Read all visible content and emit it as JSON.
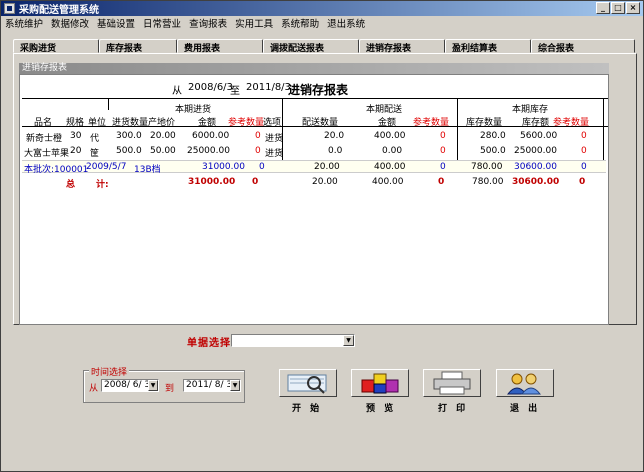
{
  "window": {
    "title": "采购配送管理系统"
  },
  "menu": [
    "系统维护",
    "数据修改",
    "基础设置",
    "日常营业",
    "查询报表",
    "实用工具",
    "系统帮助",
    "退出系统"
  ],
  "tabs": [
    "采购进货",
    "库存报表",
    "费用报表",
    "调拨配送报表",
    "进销存报表",
    "盈利结算表",
    "综合报表"
  ],
  "panel": {
    "header": "进销存报表"
  },
  "report": {
    "from_label": "从",
    "from_date": "2008/6/3",
    "to_label": "至",
    "to_date": "2011/8/3",
    "title": "进销存报表",
    "section_in": "本期进货",
    "section_out": "本期配送",
    "section_stock": "本期库存",
    "columns": {
      "name": "品名",
      "spec": "规格",
      "unit": "单位",
      "in_qty": "进货数量",
      "origin_price": "产地价",
      "in_amount": "金额",
      "in_ref_qty": "参考数量",
      "option": "选项",
      "out_qty": "配送数量",
      "out_amount": "金额",
      "out_ref_qty": "参考数量",
      "stock_qty": "库存数量",
      "stock_amount": "库存额",
      "stock_ref_qty": "参考数量"
    },
    "rows": [
      {
        "name": "新奇士橙",
        "spec": "30",
        "unit": "代",
        "in_qty": "300.0",
        "origin_price": "20.00",
        "in_amount": "6000.00",
        "in_ref": "0",
        "option": "进货",
        "out_qty": "20.0",
        "out_amount": "400.00",
        "out_ref": "0",
        "stock_qty": "280.0",
        "stock_amount": "5600.00",
        "stock_ref": "0"
      },
      {
        "name": "大富士苹果",
        "spec": "20",
        "unit": "筐",
        "in_qty": "500.0",
        "origin_price": "50.00",
        "in_amount": "25000.00",
        "in_ref": "0",
        "option": "进货",
        "out_qty": "0.0",
        "out_amount": "0.00",
        "out_ref": "0",
        "stock_qty": "500.0",
        "stock_amount": "25000.00",
        "stock_ref": "0"
      }
    ],
    "batch": {
      "label": "本批次:100001",
      "date": "2009/5/7",
      "code": "13B档",
      "in_amount": "31000.00",
      "in_ref": "0",
      "out_qty": "20.00",
      "out_amount": "400.00",
      "out_ref": "0",
      "stock_qty": "780.00",
      "stock_amount": "30600.00",
      "stock_ref": "0"
    },
    "total": {
      "label_1": "总",
      "label_2": "计:",
      "in_amount": "31000.00",
      "in_ref": "0",
      "out_qty": "20.00",
      "out_amount": "400.00",
      "out_ref": "0",
      "stock_qty": "780.00",
      "stock_amount": "30600.00",
      "stock_ref": "0"
    }
  },
  "receipt": {
    "label": "单据选择",
    "value": ""
  },
  "time": {
    "legend": "时间选择",
    "from_label": "从",
    "from_value": "2008/ 6/ 3",
    "to_label": "到",
    "to_value": "2011/ 8/ 3"
  },
  "buttons": {
    "start": "开 始",
    "preview": "预 览",
    "print": "打 印",
    "exit": "退 出"
  },
  "colors": {
    "title_start": "#0a246a",
    "title_end": "#a6caf0",
    "ref_red": "#e00000",
    "batch_blue": "#0000c0",
    "total_red": "#c00000"
  }
}
